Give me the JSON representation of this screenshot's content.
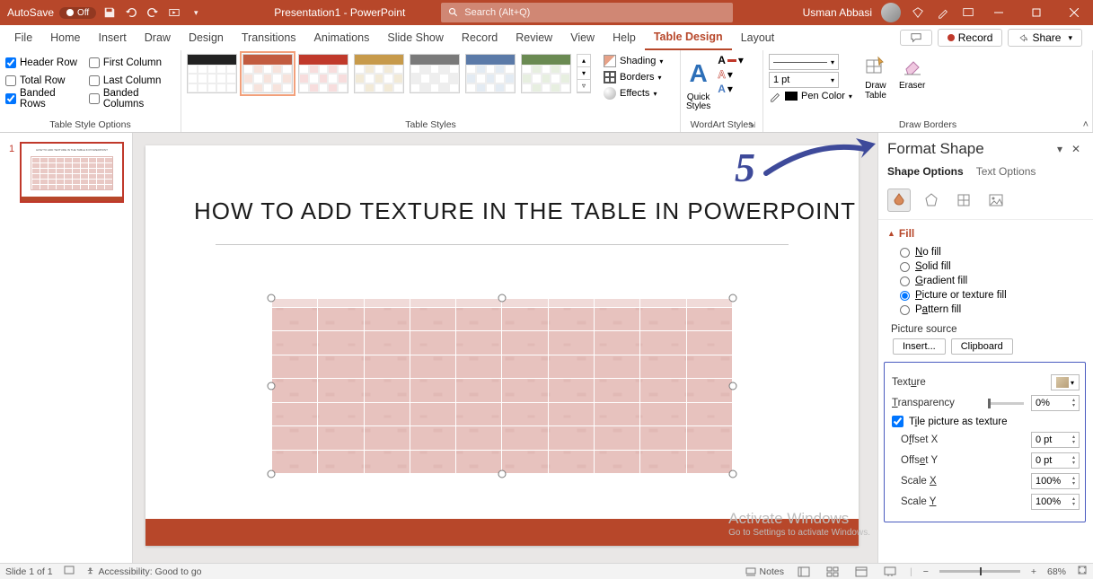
{
  "titleBar": {
    "autosave_label": "AutoSave",
    "autosave_state": "Off",
    "doc_title": "Presentation1  -  PowerPoint",
    "search_placeholder": "Search (Alt+Q)",
    "user_name": "Usman Abbasi"
  },
  "tabs": {
    "items": [
      "File",
      "Home",
      "Insert",
      "Draw",
      "Design",
      "Transitions",
      "Animations",
      "Slide Show",
      "Record",
      "Review",
      "View",
      "Help",
      "Table Design",
      "Layout"
    ],
    "active": "Table Design",
    "record_label": "Record",
    "share_label": "Share"
  },
  "ribbon": {
    "tso": {
      "header_row": "Header Row",
      "total_row": "Total Row",
      "banded_rows": "Banded Rows",
      "first_col": "First Column",
      "last_col": "Last Column",
      "banded_cols": "Banded Columns",
      "label": "Table Style Options",
      "checked": {
        "header_row": true,
        "total_row": false,
        "banded_rows": true,
        "first_col": false,
        "last_col": false,
        "banded_cols": false
      }
    },
    "ts": {
      "label": "Table Styles",
      "shading": "Shading",
      "borders": "Borders",
      "effects": "Effects"
    },
    "wa": {
      "quick_styles": "Quick\nStyles",
      "label": "WordArt Styles"
    },
    "db": {
      "pt": "1 pt",
      "pen_color": "Pen Color",
      "draw_table": "Draw\nTable",
      "eraser": "Eraser",
      "label": "Draw Borders"
    }
  },
  "slide": {
    "number": "1",
    "title": "HOW TO ADD TEXTURE  IN THE TABLE IN POWERPOINT"
  },
  "annotation": {
    "step": "5"
  },
  "formatShape": {
    "title": "Format Shape",
    "shape_options": "Shape Options",
    "text_options": "Text Options",
    "fill_title": "Fill",
    "radios": {
      "no_fill": "No fill",
      "solid": "Solid fill",
      "gradient": "Gradient fill",
      "picture": "Picture or texture fill",
      "pattern": "Pattern fill",
      "selected": "picture"
    },
    "picture_source": "Picture source",
    "insert_btn": "Insert...",
    "clipboard_btn": "Clipboard",
    "texture_label": "Texture",
    "transparency_label": "Transparency",
    "transparency_val": "0%",
    "tile_label": "Tile picture as texture",
    "tile_checked": true,
    "offset_x": "Offset X",
    "offset_x_val": "0 pt",
    "offset_y": "Offset Y",
    "offset_y_val": "0 pt",
    "scale_x": "Scale X",
    "scale_x_val": "100%",
    "scale_y": "Scale Y",
    "scale_y_val": "100%"
  },
  "statusBar": {
    "slide_of": "Slide 1 of 1",
    "accessibility": "Accessibility: Good to go",
    "notes": "Notes",
    "zoom": "68%"
  },
  "watermark": {
    "line1": "Activate Windows",
    "line2": "Go to Settings to activate Windows."
  }
}
